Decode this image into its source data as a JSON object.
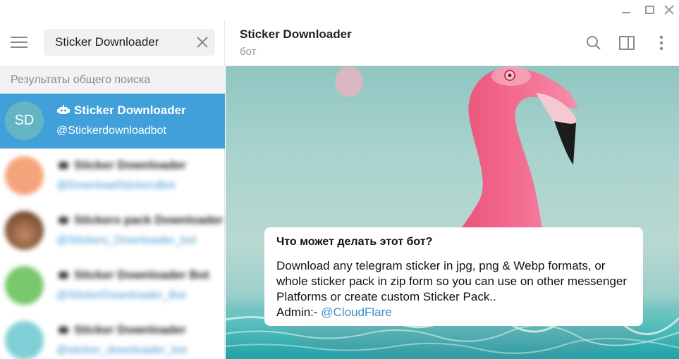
{
  "search": {
    "query": "Sticker Downloader"
  },
  "results_header": "Результаты общего поиска",
  "results": [
    {
      "initials": "SD",
      "title": "Sticker Downloader",
      "subtitle": "@Stickerdownloadbot",
      "color": "#64b5c4",
      "active": true
    },
    {
      "initials": "",
      "title": "Sticker Downloader",
      "subtitle": "@DownloadStickersBot",
      "color": "#f4a47a",
      "active": false
    },
    {
      "initials": "",
      "title": "Stickers pack Downloader",
      "subtitle": "@Stickers_Downloader_bot",
      "color": "#8a5a3c",
      "active": false
    },
    {
      "initials": "",
      "title": "Sticker Downloader Bot",
      "subtitle": "@StickerDownloader_Bot",
      "color": "#79c86b",
      "active": false
    },
    {
      "initials": "",
      "title": "Sticker Downloader",
      "subtitle": "@sticker_downloader_bot",
      "color": "#7fd0d6",
      "active": false
    }
  ],
  "chat": {
    "title": "Sticker Downloader",
    "status": "бот"
  },
  "info": {
    "title": "Что может делать этот бот?",
    "body": "Download any telegram sticker in jpg, png & Webp formats, or whole sticker pack in zip form so you can use on other messenger Platforms or create custom Sticker Pack..",
    "admin_prefix": "Admin:- ",
    "admin_link": "@CloudFlare"
  },
  "icons": {
    "menu": "hamburger-menu-icon",
    "clear": "close-icon",
    "search": "search-icon",
    "sidebar": "sidebar-toggle-icon",
    "more": "more-vertical-icon",
    "bot": "bot-icon"
  },
  "colors": {
    "accent": "#419fd9",
    "link": "#3a8fd0",
    "flamingo": "#f0577f"
  }
}
